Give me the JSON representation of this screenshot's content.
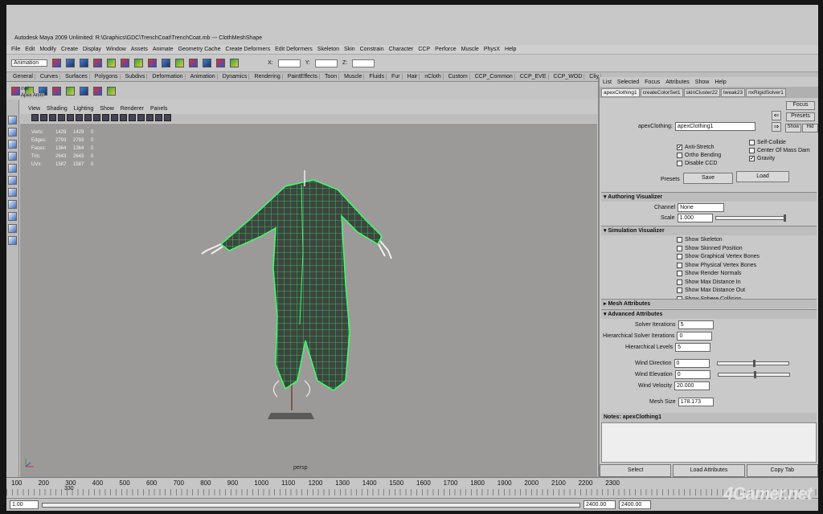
{
  "window": {
    "title": "Autodesk Maya 2009 Unlimited: R:\\Graphics\\GDC\\TrenchCoat\\TrenchCoat.mb --- ClothMeshShape"
  },
  "menubar": [
    "File",
    "Edit",
    "Modify",
    "Create",
    "Display",
    "Window",
    "Assets",
    "Animate",
    "Geometry Cache",
    "Create Deformers",
    "Edit Deformers",
    "Skeleton",
    "Skin",
    "Constrain",
    "Character",
    "CCP",
    "Perforce",
    "Muscle",
    "PhysX",
    "Help"
  ],
  "statusline": {
    "mode": "Animation",
    "x_label": "X:",
    "y_label": "Y:",
    "z_label": "Z:"
  },
  "shelf_tabs": [
    "General",
    "Curves",
    "Surfaces",
    "Polygons",
    "Subdivs",
    "Deformation",
    "Animation",
    "Dynamics",
    "Rendering",
    "PaintEffects",
    "Toon",
    "Muscle",
    "Fluids",
    "Fur",
    "Hair",
    "nCloth",
    "Custom",
    "CCP_Common",
    "CCP_EVE",
    "CCP_WOD",
    "Cliy"
  ],
  "shelf_sub": {
    "a": "mel",
    "b": "Apex Anim"
  },
  "viewport": {
    "menu": [
      "View",
      "Shading",
      "Lighting",
      "Show",
      "Renderer",
      "Panels"
    ],
    "camera": "persp",
    "hud": [
      {
        "label": "Verts:",
        "a": "1429",
        "b": "1429",
        "c": "0"
      },
      {
        "label": "Edges:",
        "a": "2793",
        "b": "2793",
        "c": "0"
      },
      {
        "label": "Faces:",
        "a": "1364",
        "b": "1364",
        "c": "0"
      },
      {
        "label": "Tris:",
        "a": "2643",
        "b": "2643",
        "c": "0"
      },
      {
        "label": "UVs:",
        "a": "1587",
        "b": "1587",
        "c": "0"
      }
    ]
  },
  "attribute_editor": {
    "menu": [
      "List",
      "Selected",
      "Focus",
      "Attributes",
      "Show",
      "Help"
    ],
    "tabs": [
      "apexClothing1",
      "createColorSet1",
      "skinCluster22",
      "tweak23",
      "nxRigidSolver1"
    ],
    "focus": "Focus",
    "presets": "Presets",
    "show": "Show",
    "hide": "Hid",
    "node_label": "apexClothing:",
    "node_value": "apexClothing1",
    "checkboxes_left": [
      {
        "label": "Anti-Stretch",
        "checked": "✔"
      },
      {
        "label": "Ortho Bending",
        "checked": ""
      },
      {
        "label": "Disable CCD",
        "checked": ""
      }
    ],
    "checkboxes_right": [
      {
        "label": "Self-Collide",
        "checked": ""
      },
      {
        "label": "Center Of Mass Dam",
        "checked": ""
      },
      {
        "label": "Gravity",
        "checked": "✔"
      }
    ],
    "presets_label": "Presets",
    "save": "Save",
    "load": "Load",
    "authoring": {
      "header": "Authoring Visualizer",
      "channel_label": "Channel",
      "channel_value": "None",
      "scale_label": "Scale",
      "scale_value": "1.000"
    },
    "simulation": {
      "header": "Simulation Visualizer",
      "items": [
        "Show Skeleton",
        "Show Skinned Position",
        "Show Graphical Vertex Bones",
        "Show Physical Vertex Bones",
        "Show Render Normals",
        "Show Max Distance In",
        "Show Max Distance Out",
        "Show Sphere Collision"
      ]
    },
    "mesh_attributes": "Mesh Attributes",
    "advanced": {
      "header": "Advanced Attributes",
      "solver_iterations_label": "Solver Iterations",
      "solver_iterations": "5",
      "hier_solver_label": "Hierarchical Solver Iterations",
      "hier_solver": "0",
      "hier_levels_label": "Hierarchical Levels",
      "hier_levels": "5",
      "wind_direction_label": "Wind Direction",
      "wind_direction": "0",
      "wind_elevation_label": "Wind Elevation",
      "wind_elevation": "0",
      "wind_velocity_label": "Wind Velocity",
      "wind_velocity": "20.000",
      "mesh_size_label": "Mesh Size",
      "mesh_size": "178.173"
    },
    "notes_label": "Notes:",
    "notes_node": "apexClothing1",
    "bottom": [
      "Select",
      "Load Attributes",
      "Copy Tab"
    ]
  },
  "timeline": {
    "labels": [
      "100",
      "200",
      "300",
      "400",
      "500",
      "600",
      "700",
      "800",
      "900",
      "1000",
      "1100",
      "1200",
      "1300",
      "1400",
      "1500",
      "1600",
      "1700",
      "1800",
      "1900",
      "2000",
      "2100",
      "2200",
      "2300"
    ],
    "current": "330"
  },
  "range": {
    "start": "1.00",
    "end_a": "2400.00",
    "end_b": "2400.00"
  },
  "watermark": "4Gamer.net"
}
